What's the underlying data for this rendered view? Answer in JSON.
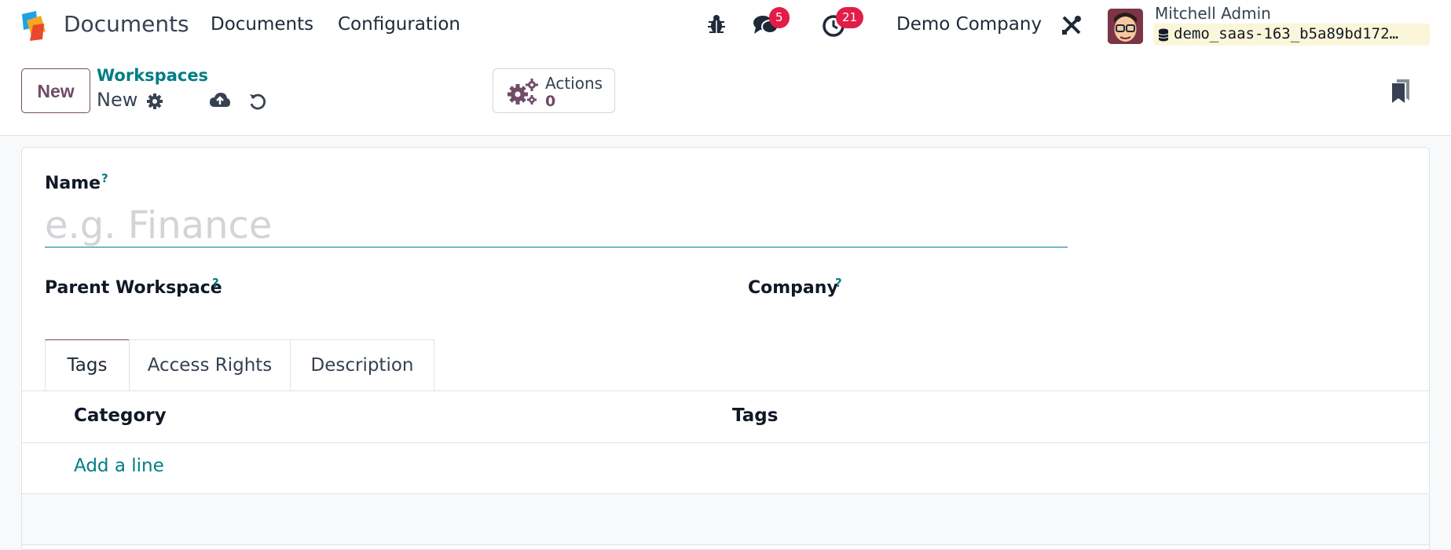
{
  "navbar": {
    "app_name": "Documents",
    "menu": [
      "Documents",
      "Configuration"
    ],
    "messages_count": "5",
    "activities_count": "21",
    "company": "Demo Company",
    "user_name": "Mitchell Admin",
    "database": "demo_saas-163_b5a89bd172…"
  },
  "control_panel": {
    "new_button": "New",
    "breadcrumb_parent": "Workspaces",
    "breadcrumb_current": "New",
    "actions_label": "Actions",
    "actions_count": "0"
  },
  "form": {
    "name_label": "Name",
    "name_placeholder": "e.g. Finance",
    "name_value": "",
    "help_mark": "?",
    "parent_label": "Parent Workspace",
    "company_label": "Company"
  },
  "tabs": [
    "Tags",
    "Access Rights",
    "Description"
  ],
  "tags_list": {
    "columns": [
      "Category",
      "Tags"
    ],
    "add_line": "Add a line"
  },
  "colors": {
    "brand": "#714b67",
    "link": "#017e84",
    "badge": "#e11d48"
  },
  "icons": {
    "debug": "bug-icon",
    "messages": "chat-icon",
    "activities": "clock-icon",
    "settings": "tools-icon",
    "record_settings": "gear-icon",
    "save": "cloud-upload-icon",
    "discard": "undo-icon",
    "actions": "gears-icon",
    "db": "database-icon",
    "bookmark": "bookmark-icon"
  }
}
